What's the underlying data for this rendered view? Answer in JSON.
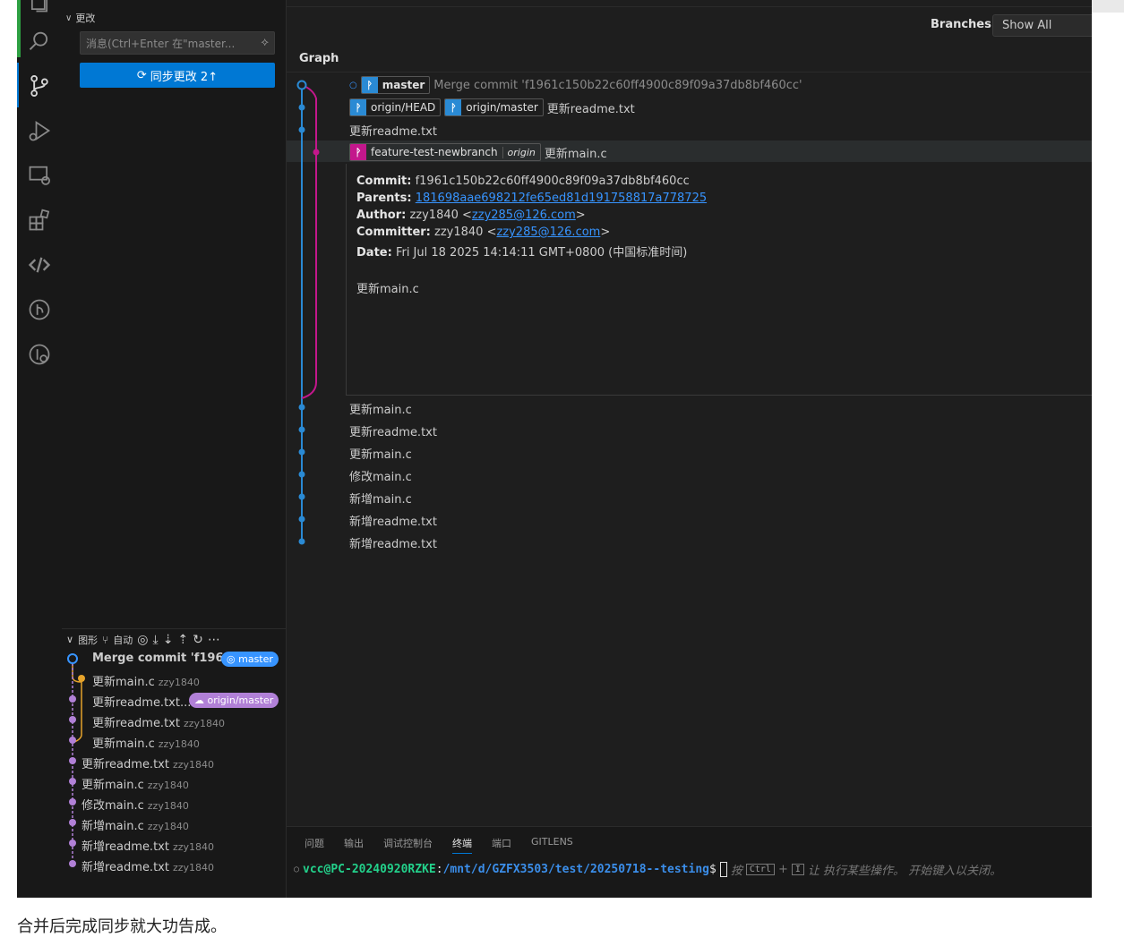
{
  "caption": "合并后完成同步就大功告成。",
  "sidebar": {
    "changes_header": "更改",
    "message_placeholder": "消息(Ctrl+Enter 在\"master...",
    "sync_button": "同步更改 2↑",
    "graph_header": "图形",
    "graph_mode": "自动",
    "graph_commits": [
      {
        "msg": "Merge commit 'f1961...",
        "author": "",
        "badge": "master"
      },
      {
        "msg": "更新main.c",
        "author": "zzy1840",
        "badge": ""
      },
      {
        "msg": "更新readme.txt...",
        "author": "",
        "badge": "origin/master"
      },
      {
        "msg": "更新readme.txt",
        "author": "zzy1840",
        "badge": ""
      },
      {
        "msg": "更新main.c",
        "author": "zzy1840",
        "badge": ""
      },
      {
        "msg": "更新readme.txt",
        "author": "zzy1840",
        "badge": ""
      },
      {
        "msg": "更新main.c",
        "author": "zzy1840",
        "badge": ""
      },
      {
        "msg": "修改main.c",
        "author": "zzy1840",
        "badge": ""
      },
      {
        "msg": "新增main.c",
        "author": "zzy1840",
        "badge": ""
      },
      {
        "msg": "新增readme.txt",
        "author": "zzy1840",
        "badge": ""
      },
      {
        "msg": "新增readme.txt",
        "author": "zzy1840",
        "badge": ""
      }
    ]
  },
  "main": {
    "branches_label": "Branches:",
    "branches_value": "Show All",
    "graph_tab": "Graph",
    "commits": [
      {
        "refs": [
          {
            "name": "master",
            "type": "blue",
            "bold": true
          }
        ],
        "msg": "Merge commit 'f1961c150b22c60ff4900c89f09a37db8bf460cc'"
      },
      {
        "refs": [
          {
            "name": "origin/HEAD",
            "type": "blue"
          },
          {
            "name": "origin/master",
            "type": "blue"
          }
        ],
        "msg": "更新readme.txt"
      },
      {
        "refs": [],
        "msg": "更新readme.txt"
      },
      {
        "refs": [
          {
            "name": "feature-test-newbranch",
            "type": "pink",
            "origin": "origin"
          }
        ],
        "msg": "更新main.c"
      }
    ],
    "details": {
      "commit_label": "Commit:",
      "commit": "f1961c150b22c60ff4900c89f09a37db8bf460cc",
      "parents_label": "Parents:",
      "parents": "181698aae698212fe65ed81d191758817a778725",
      "author_label": "Author:",
      "author_name": "zzy1840 <",
      "author_email": "zzy285@126.com",
      "committer_label": "Committer:",
      "committer_name": "zzy1840 <",
      "committer_email": "zzy285@126.com",
      "date_label": "Date:",
      "date": "Fri Jul 18 2025 14:14:11 GMT+0800 (中国标准时间)",
      "message": "更新main.c"
    },
    "lower_commits": [
      "更新main.c",
      "更新readme.txt",
      "更新main.c",
      "修改main.c",
      "新增main.c",
      "新增readme.txt",
      "新增readme.txt"
    ]
  },
  "panel": {
    "tabs": [
      "问题",
      "输出",
      "调试控制台",
      "终端",
      "端口",
      "GITLENS"
    ],
    "active_tab": "终端",
    "prompt_user": "vcc@PC-20240920RZKE",
    "prompt_path": "/mnt/d/GZFX3503/test/20250718--testing",
    "hint_pre": "按",
    "key1": "Ctrl",
    "key2": "I",
    "hint_post": "让 执行某些操作。 开始键入以关闭。"
  },
  "colors": {
    "accent": "#0078d4",
    "branch_blue": "#2a8ad4",
    "branch_pink": "#c3178c",
    "badge_purple": "#b180d7"
  }
}
